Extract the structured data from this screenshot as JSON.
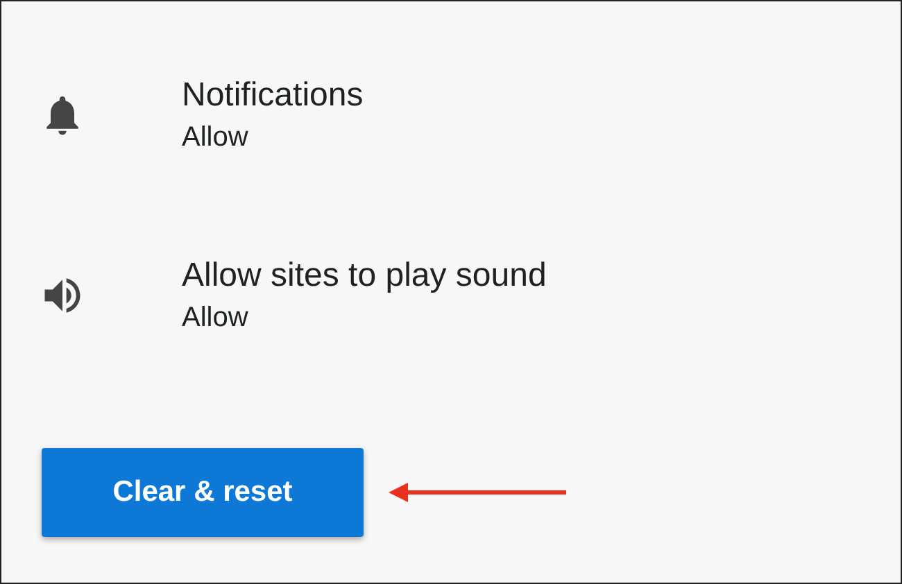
{
  "settings": [
    {
      "kind": "notifications",
      "title": "Notifications",
      "value": "Allow"
    },
    {
      "kind": "sound",
      "title": "Allow sites to play sound",
      "value": "Allow"
    }
  ],
  "button": {
    "label": "Clear & reset"
  }
}
